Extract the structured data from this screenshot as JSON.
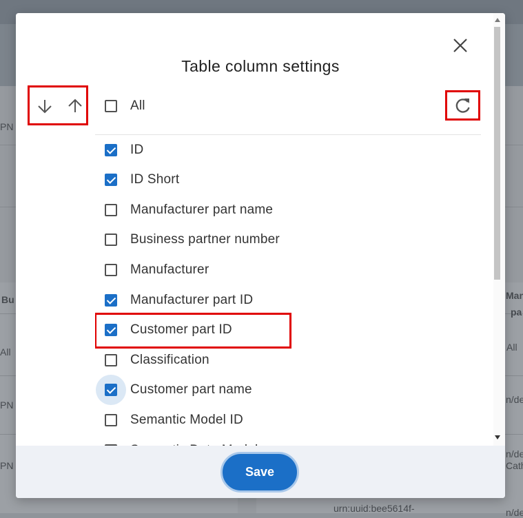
{
  "dialog": {
    "title": "Table column settings",
    "all_label": "All",
    "save_label": "Save",
    "columns": [
      {
        "label": "ID",
        "checked": true
      },
      {
        "label": "ID Short",
        "checked": true
      },
      {
        "label": "Manufacturer part name",
        "checked": false
      },
      {
        "label": "Business partner number",
        "checked": false
      },
      {
        "label": "Manufacturer",
        "checked": false
      },
      {
        "label": "Manufacturer part ID",
        "checked": true
      },
      {
        "label": "Customer part ID",
        "checked": true
      },
      {
        "label": "Classification",
        "checked": false
      },
      {
        "label": "Customer part name",
        "checked": true
      },
      {
        "label": "Semantic Model ID",
        "checked": false
      },
      {
        "label": "Semantic Data Model",
        "checked": false
      }
    ],
    "all_checked": false
  },
  "background": {
    "left_texts": [
      "PN",
      "Bu",
      "All",
      "PN",
      "PN"
    ],
    "right_texts": [
      "Man",
      "pa",
      "All",
      "n/de",
      "n/de",
      "Cath",
      "n/de"
    ],
    "bottom_text": "urn:uuid:bee5614f-"
  },
  "colors": {
    "accent": "#1b6fc7",
    "highlight": "#e00000",
    "footer": "#eef1f6"
  },
  "icons": {
    "close": "close-icon",
    "sort_down": "arrow-down-icon",
    "sort_up": "arrow-up-icon",
    "reset": "refresh-icon"
  }
}
